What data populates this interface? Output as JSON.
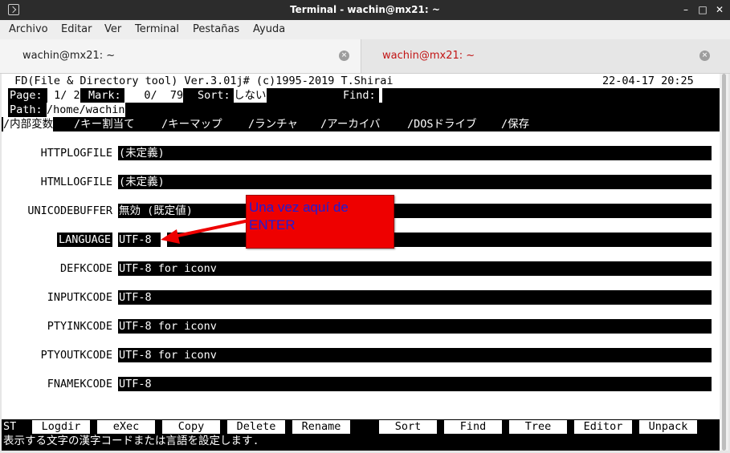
{
  "window": {
    "title": "Terminal - wachin@mx21: ~",
    "minimize": "–",
    "maximize": "□",
    "close": "✕"
  },
  "menu": [
    "Archivo",
    "Editar",
    "Ver",
    "Terminal",
    "Pestañas",
    "Ayuda"
  ],
  "tabs": [
    {
      "label": "wachin@mx21: ~",
      "close": "×"
    },
    {
      "label": "wachin@mx21: ~",
      "close": "×"
    }
  ],
  "fd": {
    "header_title": " FD(File & Directory tool) Ver.3.01j# (c)1995-2019 T.Shirai",
    "header_datetime": "22-04-17 20:25",
    "page_label": "Page:",
    "page_value": " 1/ 2",
    "mark_label": "Mark:",
    "mark_value": "   0/  79",
    "sort_label": "Sort:",
    "sort_value": "しない",
    "find_label": "Find:",
    "path_label": "Path:",
    "path_value": "/home/wachin",
    "menu_tabs": [
      "/内部変数",
      "/キー割当て",
      "/キーマップ",
      "/ランチャ",
      "/アーカイバ",
      "/DOSドライブ",
      "/保存"
    ],
    "variables": [
      {
        "name": "HTTPLOGFILE",
        "value": "(未定義)"
      },
      {
        "name": "HTMLLOGFILE",
        "value": "(未定義)"
      },
      {
        "name": "UNICODEBUFFER",
        "value": "無効 (既定値)"
      },
      {
        "name": "LANGUAGE",
        "value": "UTF-8"
      },
      {
        "name": "DEFKCODE",
        "value": "UTF-8 for iconv"
      },
      {
        "name": "INPUTKCODE",
        "value": "UTF-8"
      },
      {
        "name": "PTYINKCODE",
        "value": "UTF-8 for iconv"
      },
      {
        "name": "PTYOUTKCODE",
        "value": "UTF-8 for iconv"
      },
      {
        "name": "FNAMEKCODE",
        "value": "UTF-8"
      }
    ],
    "st_label": "ST",
    "function_keys": [
      "Logdir",
      "eXec",
      "Copy",
      "Delete",
      "Rename",
      "Sort",
      "Find",
      "Tree",
      "Editor",
      "Unpack"
    ],
    "status_line": "表示する文字の漢字コードまたは言語を設定します."
  },
  "annotation": {
    "text": "Una vez aquí de ENTER",
    "box_color": "#ee0000",
    "text_color": "#1d1dd8"
  }
}
